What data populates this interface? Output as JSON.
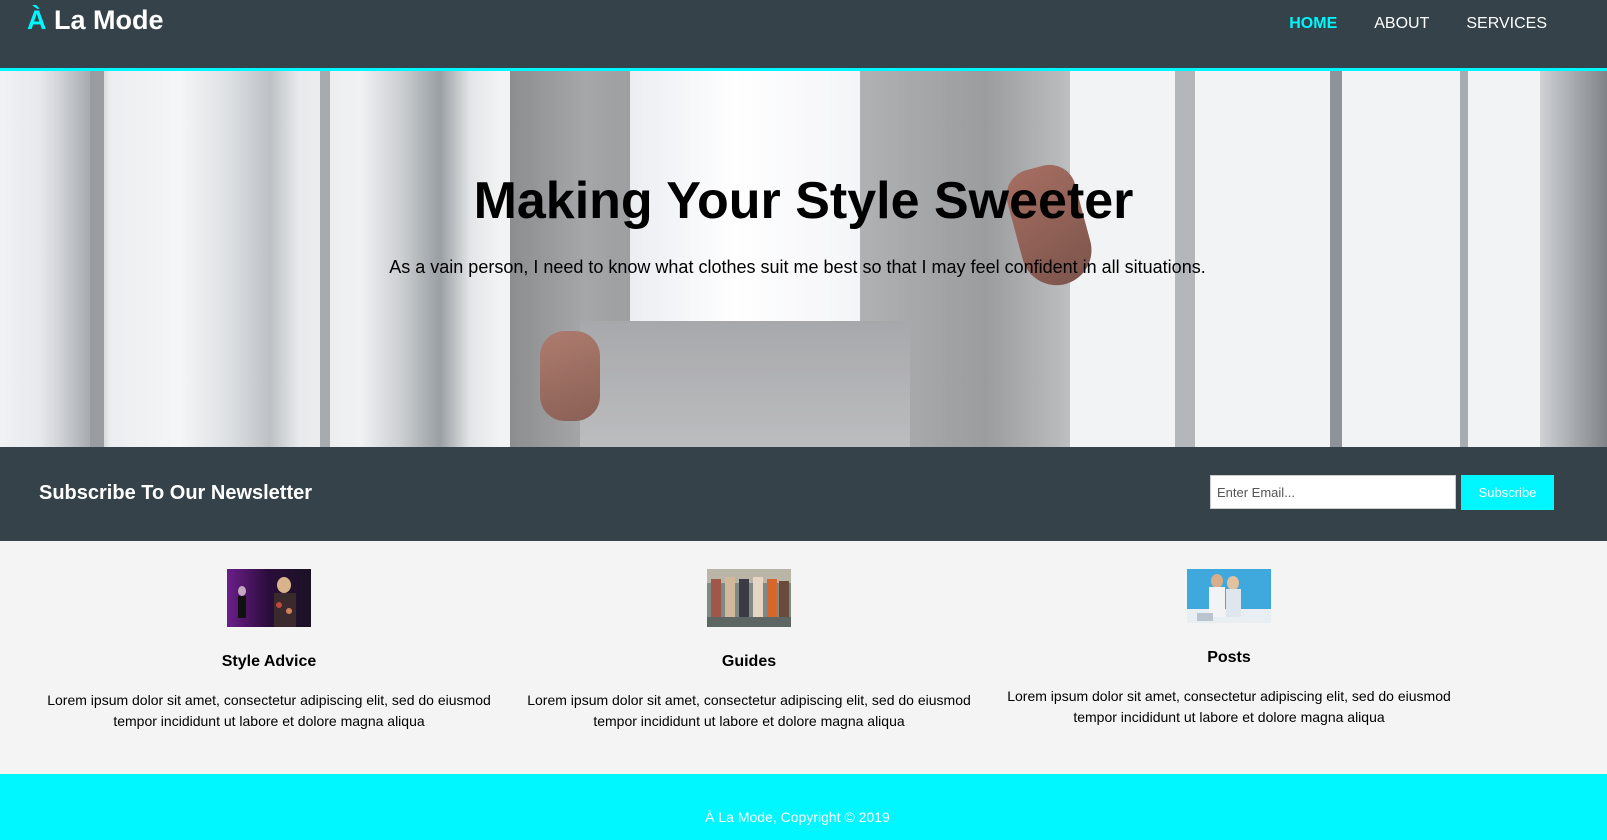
{
  "header": {
    "brand_accent": "À",
    "brand_rest": " La Mode",
    "nav": [
      {
        "label": "HOME",
        "active": true
      },
      {
        "label": "ABOUT",
        "active": false
      },
      {
        "label": "SERVICES",
        "active": false
      }
    ]
  },
  "hero": {
    "title": "Making Your Style Sweeter",
    "subtitle": "As a vain person, I need to know what clothes suit me best so that I may feel confident in all situations."
  },
  "newsletter": {
    "title": "Subscribe To Our Newsletter",
    "email_placeholder": "Enter Email...",
    "button_label": "Subscribe"
  },
  "boxes": [
    {
      "title": "Style Advice",
      "text": "Lorem ipsum dolor sit amet, consectetur adipiscing elit, sed do eiusmod tempor incididunt ut labore et dolore magna aliqua"
    },
    {
      "title": "Guides",
      "text": "Lorem ipsum dolor sit amet, consectetur adipiscing elit, sed do eiusmod tempor incididunt ut labore et dolore magna aliqua"
    },
    {
      "title": "Posts",
      "text": "Lorem ipsum dolor sit amet, consectetur adipiscing elit, sed do eiusmod tempor incididunt ut labore et dolore magna aliqua"
    }
  ],
  "footer": {
    "text": "À La Mode, Copyright © 2019"
  },
  "colors": {
    "header_bg": "#35424a",
    "accent": "#00f7ff",
    "body_bg": "#f4f4f4"
  }
}
